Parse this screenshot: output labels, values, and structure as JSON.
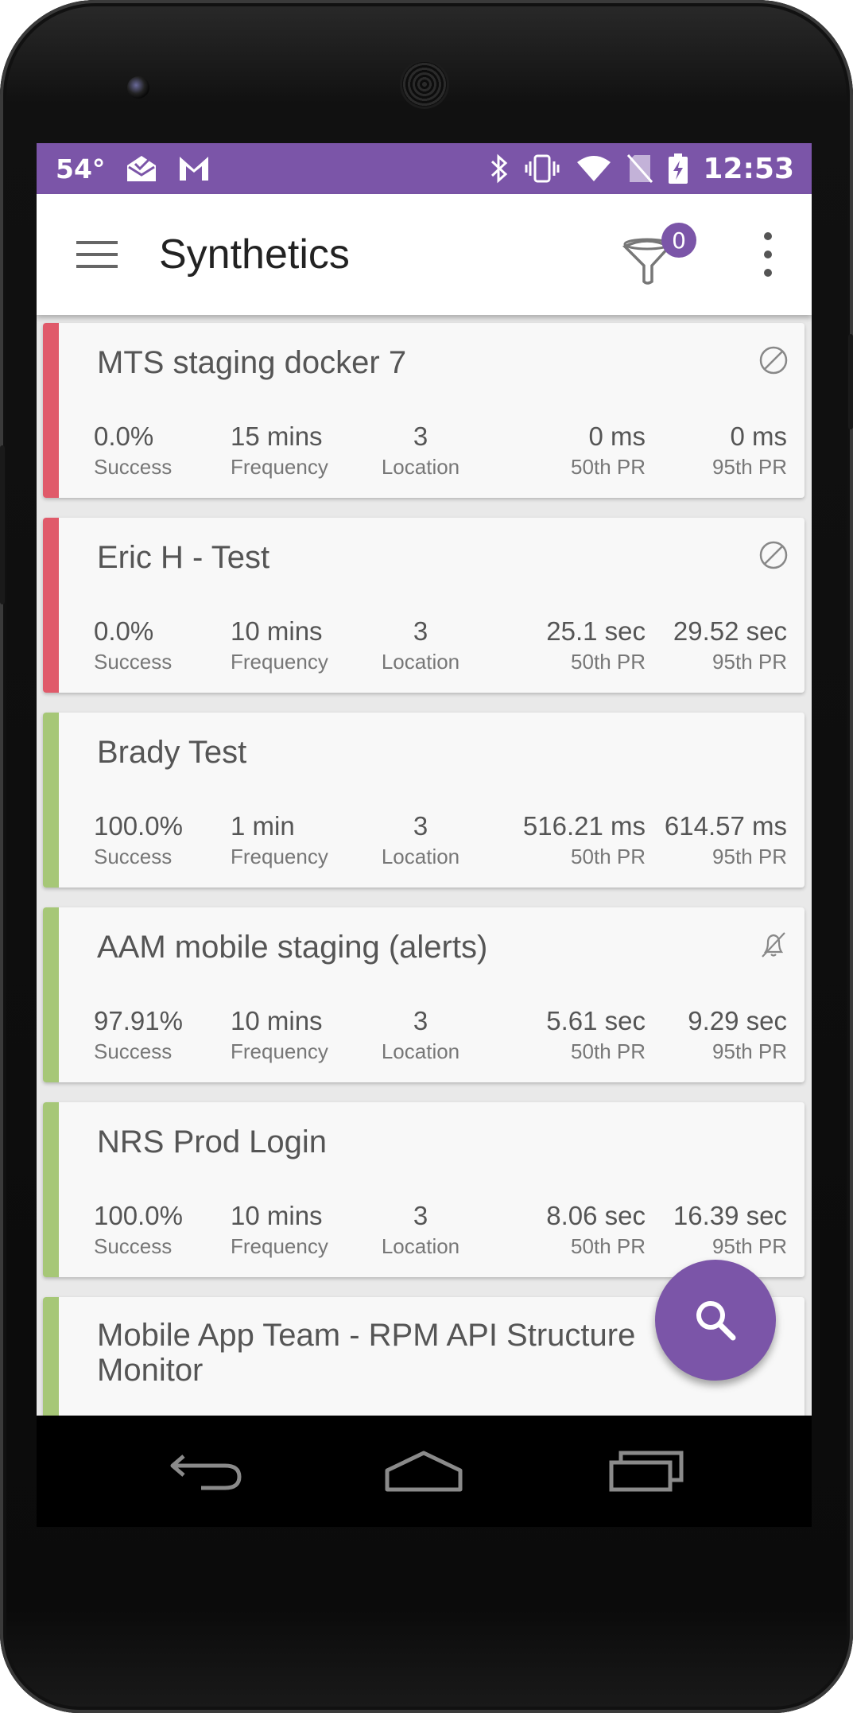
{
  "status_bar": {
    "temperature": "54°",
    "time": "12:53",
    "left_icons": [
      "mail-open-icon",
      "gmail-icon"
    ],
    "right_icons": [
      "bluetooth-icon",
      "vibrate-icon",
      "wifi-icon",
      "no-sim-icon",
      "battery-charging-icon"
    ]
  },
  "app_bar": {
    "title": "Synthetics",
    "filter_count": "0"
  },
  "colors": {
    "accent": "#7b55a8",
    "fail": "#e05a6a",
    "ok": "#a6c777"
  },
  "monitors": [
    {
      "name": "MTS staging docker 7",
      "status": "fail",
      "state_icon": "disabled-icon",
      "success": "0.0%",
      "success_label": "Success",
      "frequency": "15 mins",
      "frequency_label": "Frequency",
      "location": "3",
      "location_label": "Location",
      "p50": "0 ms",
      "p50_label": "50th PR",
      "p95": "0 ms",
      "p95_label": "95th PR"
    },
    {
      "name": "Eric H - Test",
      "status": "fail",
      "state_icon": "disabled-icon",
      "success": "0.0%",
      "success_label": "Success",
      "frequency": "10 mins",
      "frequency_label": "Frequency",
      "location": "3",
      "location_label": "Location",
      "p50": "25.1 sec",
      "p50_label": "50th PR",
      "p95": "29.52 sec",
      "p95_label": "95th PR"
    },
    {
      "name": "Brady Test",
      "status": "ok",
      "state_icon": "",
      "success": "100.0%",
      "success_label": "Success",
      "frequency": "1 min",
      "frequency_label": "Frequency",
      "location": "3",
      "location_label": "Location",
      "p50": "516.21 ms",
      "p50_label": "50th PR",
      "p95": "614.57 ms",
      "p95_label": "95th PR"
    },
    {
      "name": "AAM mobile staging (alerts)",
      "status": "ok",
      "state_icon": "muted-bell-icon",
      "success": "97.91%",
      "success_label": "Success",
      "frequency": "10 mins",
      "frequency_label": "Frequency",
      "location": "3",
      "location_label": "Location",
      "p50": "5.61 sec",
      "p50_label": "50th PR",
      "p95": "9.29 sec",
      "p95_label": "95th PR"
    },
    {
      "name": "NRS Prod Login",
      "status": "ok",
      "state_icon": "",
      "success": "100.0%",
      "success_label": "Success",
      "frequency": "10 mins",
      "frequency_label": "Frequency",
      "location": "3",
      "location_label": "Location",
      "p50": "8.06 sec",
      "p50_label": "50th PR",
      "p95": "16.39 sec",
      "p95_label": "95th PR"
    },
    {
      "name": "Mobile App Team - RPM API Structure Monitor",
      "status": "ok",
      "state_icon": ""
    }
  ],
  "fab": {
    "icon": "search-icon"
  },
  "nav_bar": {
    "icons": [
      "back-icon",
      "home-icon",
      "recents-icon"
    ]
  }
}
